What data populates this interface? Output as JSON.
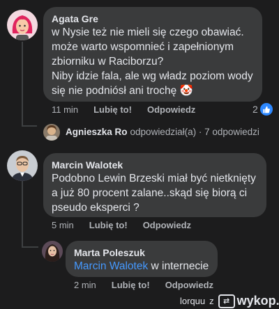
{
  "comments": [
    {
      "author": "Agata Gre",
      "lines": [
        "w Nysie też nie mieli się czego obawiać.",
        "może warto wspomnieć i zapełnionym",
        "zbiorniku w Raciborzu?",
        "Niby idzie fala, ale wg władz poziom wody",
        "się nie podniósł ani trochę 🤡"
      ],
      "time": "11 min",
      "like": "Lubię to!",
      "reply": "Odpowiedz",
      "reaction_count": "2",
      "collapsed_reply": {
        "name": "Agnieszka Ro",
        "text": "odpowiedział(a) · 7 odpowiedzi"
      }
    },
    {
      "author": "Marcin Walotek",
      "lines": [
        "Podobno Lewin Brzeski miał być nietknięty",
        "a już 80 procent zalane..skąd się biorą ci",
        "pseudo eksperci ?"
      ],
      "time": "5 min",
      "like": "Lubię to!",
      "reply": "Odpowiedz"
    },
    {
      "author": "Marta Poleszuk",
      "mention": "Marcin Walotek",
      "text_after_mention": " w internecie",
      "time": "2 min",
      "like": "Lubię to!",
      "reply": "Odpowiedz"
    }
  ],
  "watermark": {
    "user": "lorquu",
    "sep": "z",
    "site": "wykop.pl"
  },
  "colors": {
    "background": "#1c1c1d",
    "bubble": "#3a3b3c",
    "mention": "#4599ff",
    "like_badge": "#2d88ff"
  }
}
